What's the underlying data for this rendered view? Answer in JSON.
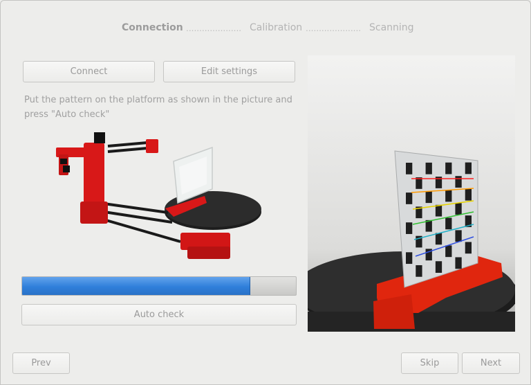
{
  "wizard": {
    "steps": [
      {
        "label": "Connection",
        "active": true
      },
      {
        "label": "Calibration",
        "active": false
      },
      {
        "label": "Scanning",
        "active": false
      }
    ],
    "separator": "....................."
  },
  "toolbar": {
    "connect_label": "Connect",
    "edit_settings_label": "Edit settings"
  },
  "instructions": "Put the pattern on the platform as shown in the picture and press \"Auto check\"",
  "progress": {
    "fraction": 0.83
  },
  "auto_check_label": "Auto check",
  "navigation": {
    "prev_label": "Prev",
    "skip_label": "Skip",
    "next_label": "Next"
  },
  "colors": {
    "progress_fill": "#2f7fda",
    "scanner_red": "#e01818",
    "platform_black": "#222222"
  },
  "images": {
    "scanner_illustration": "3d-scanner-with-calibration-pattern",
    "camera_view": "camera-view-checkerboard-pattern-on-platform"
  }
}
